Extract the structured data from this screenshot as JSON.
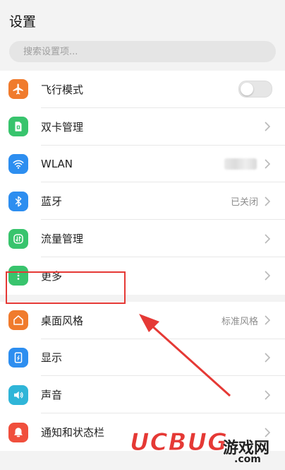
{
  "header": {
    "title": "设置"
  },
  "search": {
    "placeholder": "搜索设置项..."
  },
  "groups": [
    {
      "items": [
        {
          "label": "飞行模式",
          "icon": "airplane-icon",
          "color": "#f07b2d",
          "control": "toggle",
          "state": "off"
        },
        {
          "label": "双卡管理",
          "icon": "sim-card-icon",
          "color": "#38c46d",
          "control": "chevron"
        },
        {
          "label": "WLAN",
          "icon": "wifi-icon",
          "color": "#2d8ef0",
          "control": "chevron",
          "value_hidden": true
        },
        {
          "label": "蓝牙",
          "icon": "bluetooth-icon",
          "color": "#2d8ef0",
          "control": "chevron",
          "value": "已关闭"
        },
        {
          "label": "流量管理",
          "icon": "data-usage-icon",
          "color": "#38c46d",
          "control": "chevron"
        },
        {
          "label": "更多",
          "icon": "more-icon",
          "color": "#38c46d",
          "control": "chevron"
        }
      ]
    },
    {
      "items": [
        {
          "label": "桌面风格",
          "icon": "home-icon",
          "color": "#f07b2d",
          "control": "chevron",
          "value": "标准风格"
        },
        {
          "label": "显示",
          "icon": "display-icon",
          "color": "#2d8ef0",
          "control": "chevron"
        },
        {
          "label": "声音",
          "icon": "speaker-icon",
          "color": "#2fb5d8",
          "control": "chevron"
        },
        {
          "label": "通知和状态栏",
          "icon": "notification-icon",
          "color": "#f04f3d",
          "control": "chevron"
        }
      ]
    }
  ],
  "annotation": {
    "highlight_color": "#e53935"
  },
  "watermark": {
    "brand": "UCBUG",
    "cn": "游戏网",
    "domain": ".com"
  }
}
